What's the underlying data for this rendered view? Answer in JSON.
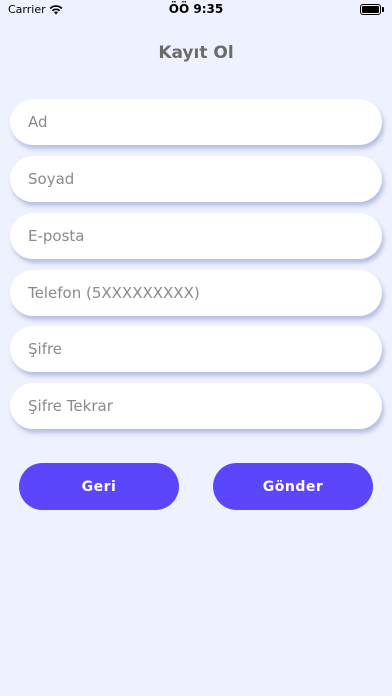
{
  "status_bar": {
    "carrier": "Carrier",
    "time": "ÖÖ 9:35",
    "wifi_icon": "wifi-icon",
    "battery_icon": "battery-icon"
  },
  "page": {
    "title": "Kayıt Ol"
  },
  "form": {
    "fields": [
      {
        "placeholder": "Ad"
      },
      {
        "placeholder": "Soyad"
      },
      {
        "placeholder": "E-posta"
      },
      {
        "placeholder": "Telefon (5XXXXXXXXX)"
      },
      {
        "placeholder": "Şifre"
      },
      {
        "placeholder": "Şifre Tekrar"
      }
    ]
  },
  "buttons": {
    "back_label": "Geri",
    "submit_label": "Gönder"
  },
  "colors": {
    "background": "#EEF2FE",
    "accent": "#5B47FB",
    "title_text": "#6B6B6B",
    "placeholder_text": "#8A8A8A"
  }
}
